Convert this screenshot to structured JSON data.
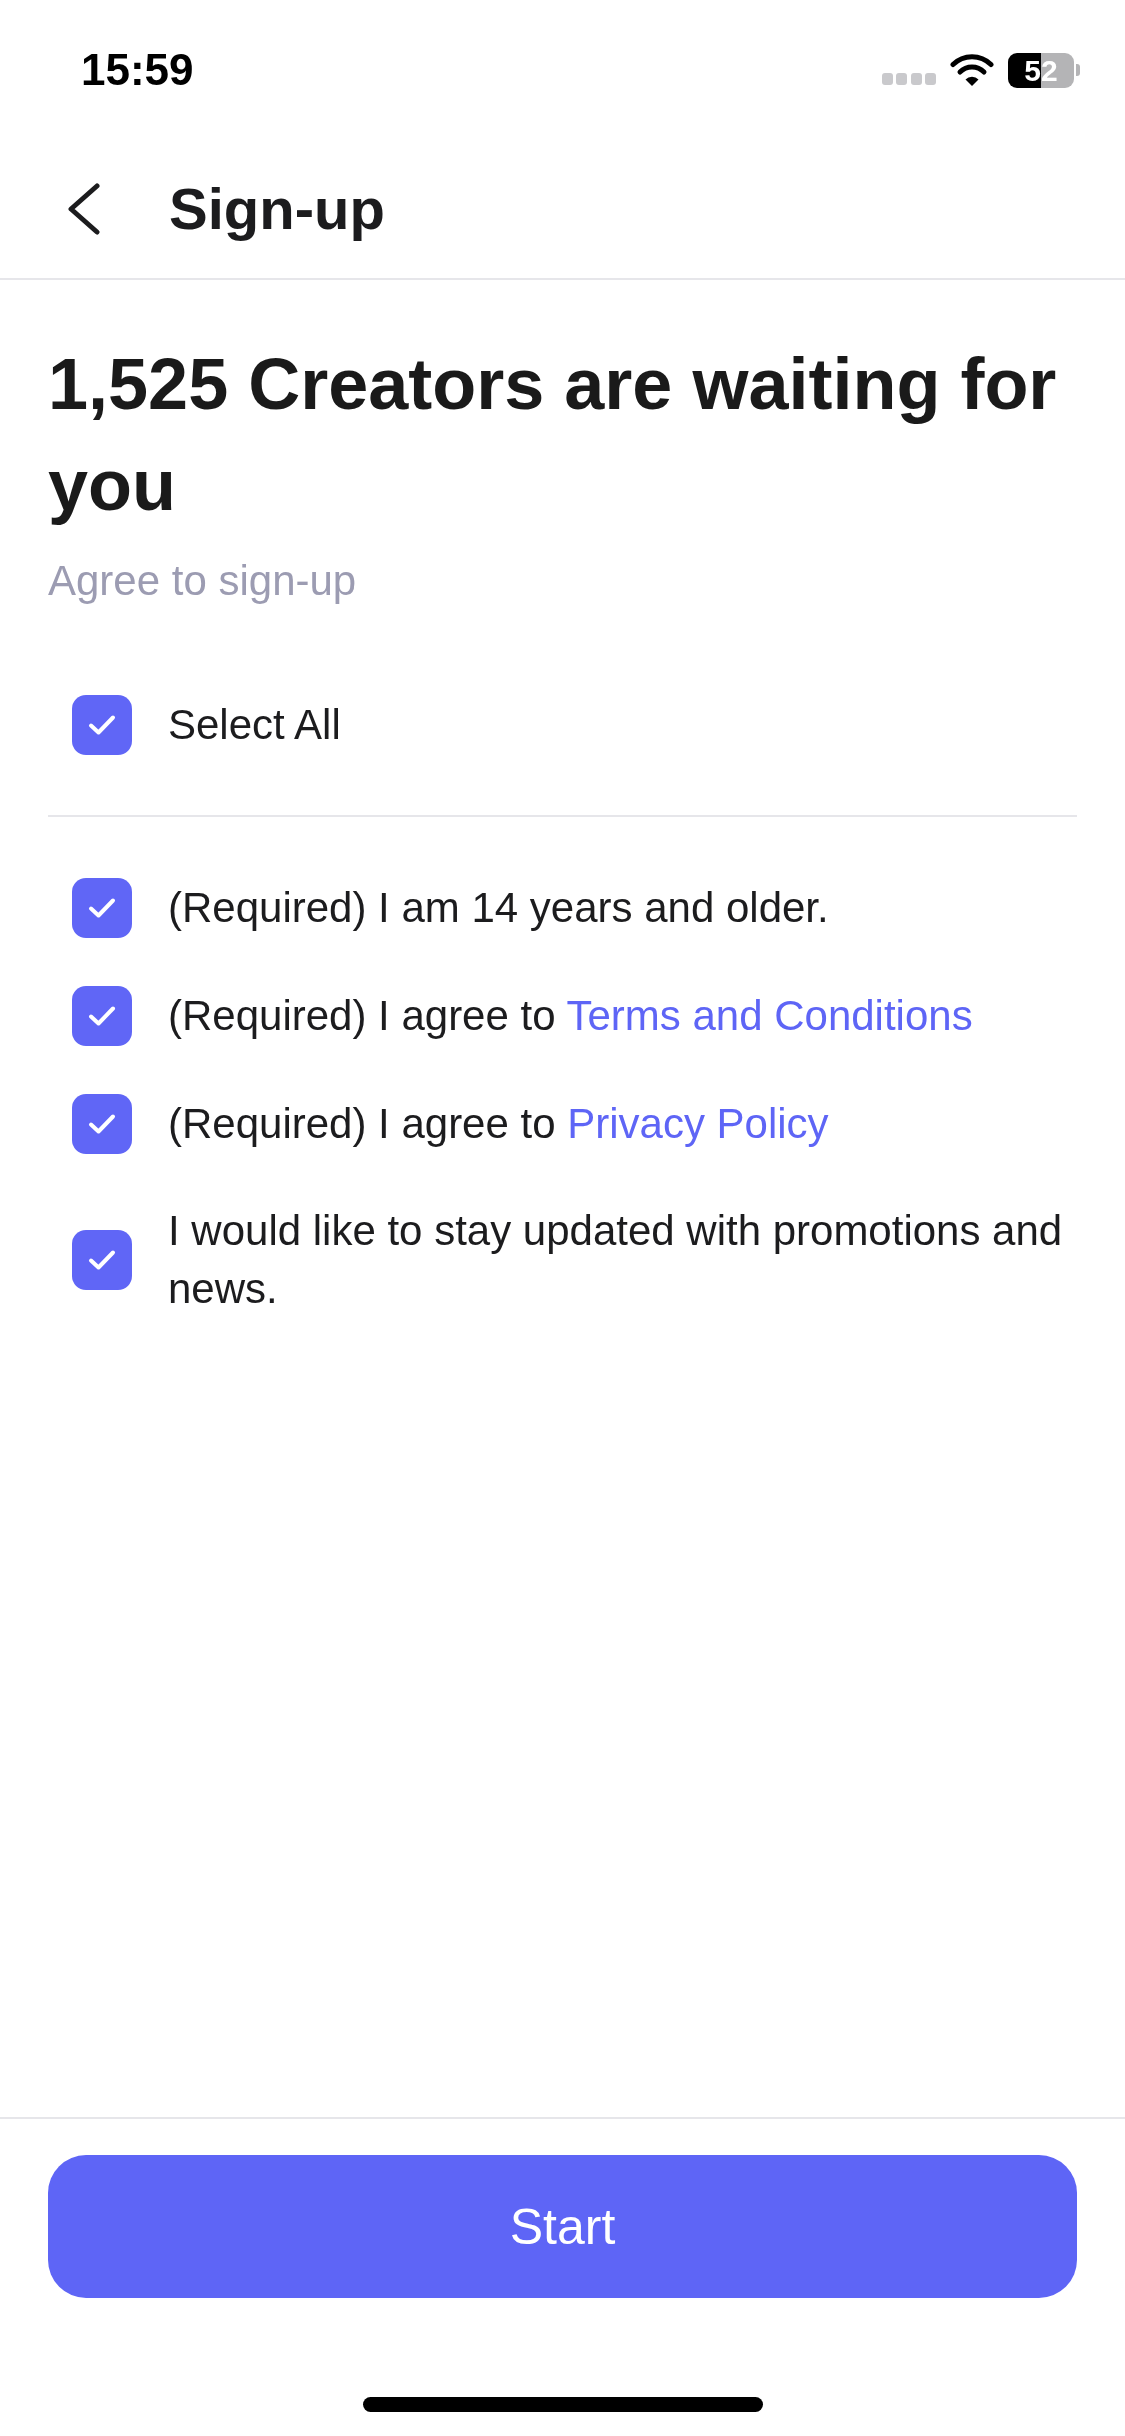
{
  "status_bar": {
    "time": "15:59",
    "battery": "52"
  },
  "header": {
    "title": "Sign-up"
  },
  "intro": {
    "heading": "1,525 Creators are waiting for you",
    "subtitle": "Agree to sign-up"
  },
  "select_all": {
    "label": "Select All",
    "checked": true
  },
  "agreements": [
    {
      "text": "(Required) I am 14 years and older.",
      "checked": true
    },
    {
      "text": "(Required) I agree to",
      "link": "Terms and Conditions",
      "checked": true
    },
    {
      "text": "(Required) I agree to",
      "link": "Privacy Policy",
      "checked": true
    },
    {
      "text": "I would like to stay updated with promotions and news.",
      "checked": true
    }
  ],
  "primary_button": {
    "label": "Start"
  }
}
